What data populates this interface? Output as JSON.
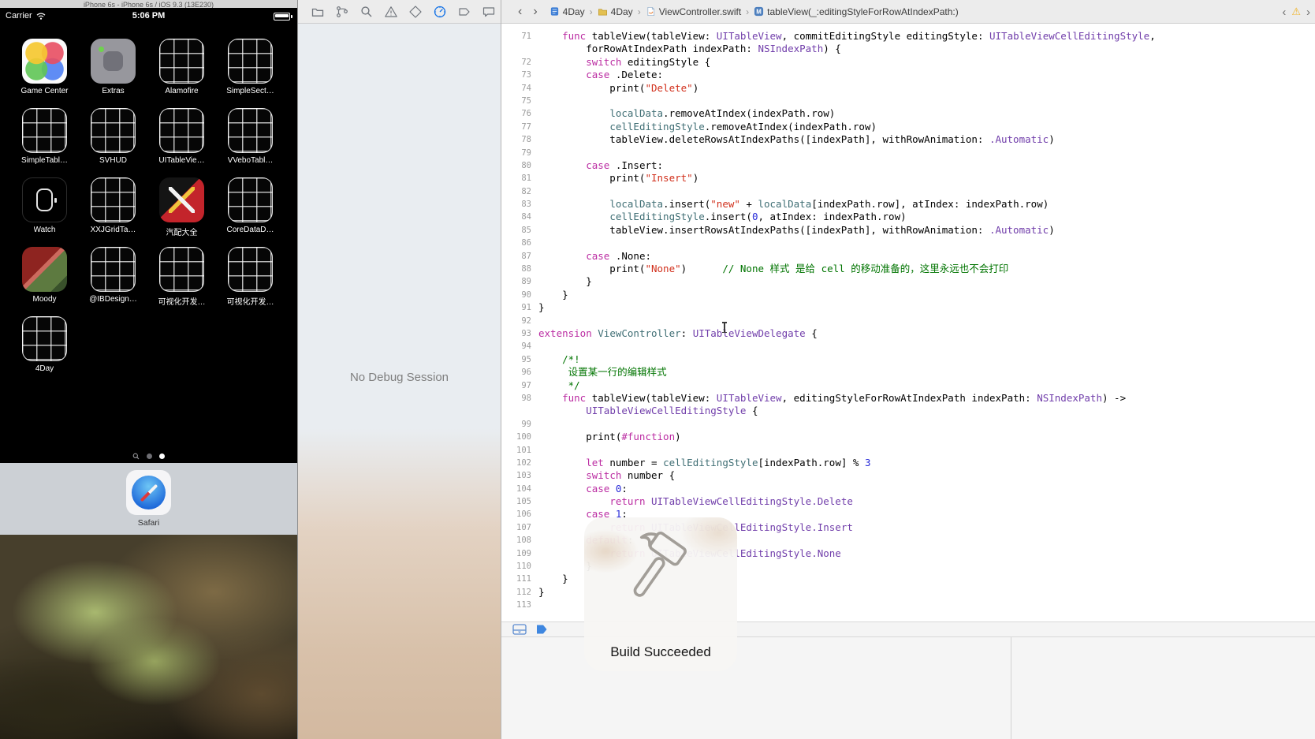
{
  "colors": {
    "accent_blue": "#1472e6",
    "warning_yellow": "#f0b429",
    "syntax": {
      "keyword": "#BB2CA2",
      "type": "#703DAA",
      "project": "#3F6E74",
      "string": "#D12F1B",
      "number": "#272AD8",
      "comment": "#007400",
      "plain": "#000000"
    }
  },
  "simulator": {
    "window_title": "iPhone 6s - iPhone 6s / iOS 9.3 (13E230)",
    "status_bar": {
      "carrier": "Carrier",
      "time": "5:06 PM",
      "icons": [
        "wifi-icon",
        "battery-icon"
      ]
    },
    "apps": [
      {
        "label": "Game Center",
        "icon": "gamecenter"
      },
      {
        "label": "Extras",
        "icon": "extras"
      },
      {
        "label": "Alamofire",
        "icon": "wire"
      },
      {
        "label": "SimpleSect…",
        "icon": "wire"
      },
      {
        "label": "SimpleTabl…",
        "icon": "wire"
      },
      {
        "label": "SVHUD",
        "icon": "wire"
      },
      {
        "label": "UITableVie…",
        "icon": "wire"
      },
      {
        "label": "VVeboTabl…",
        "icon": "wire"
      },
      {
        "label": "Watch",
        "icon": "watch"
      },
      {
        "label": "XXJGridTa…",
        "icon": "wire"
      },
      {
        "label": "汽配大全",
        "icon": "tools"
      },
      {
        "label": "CoreDataD…",
        "icon": "wire"
      },
      {
        "label": "Moody",
        "icon": "moody"
      },
      {
        "label": "@IBDesign…",
        "icon": "wire"
      },
      {
        "label": "可视化开发…",
        "icon": "wire"
      },
      {
        "label": "可视化开发…",
        "icon": "wire"
      },
      {
        "label": "4Day",
        "icon": "wire"
      }
    ],
    "page_indicator": {
      "icons": [
        "spotlight-search-icon",
        "page-dot",
        "page-dot-current"
      ],
      "current_page": 2
    },
    "dock": {
      "apps": [
        {
          "label": "Safari",
          "icon": "safari"
        }
      ]
    }
  },
  "xcode": {
    "navigator": {
      "items": [
        {
          "name": "project-navigator",
          "selected": false
        },
        {
          "name": "source-control-navigator",
          "selected": false
        },
        {
          "name": "find-navigator",
          "selected": false
        },
        {
          "name": "issue-navigator",
          "selected": false
        },
        {
          "name": "test-navigator",
          "selected": false
        },
        {
          "name": "debug-navigator",
          "selected": true
        },
        {
          "name": "breakpoint-navigator",
          "selected": false
        },
        {
          "name": "report-navigator",
          "selected": false
        }
      ]
    },
    "debug_panel": {
      "message": "No Debug Session"
    },
    "jump_bar": {
      "breadcrumbs": [
        {
          "label": "4Day",
          "icon": "project-icon"
        },
        {
          "label": "4Day",
          "icon": "folder-icon"
        },
        {
          "label": "ViewController.swift",
          "icon": "swift-file-icon"
        },
        {
          "label": "tableView(_:editingStyleForRowAtIndexPath:)",
          "icon": "method-icon"
        }
      ],
      "right_icons": [
        "previous-issue",
        "warning",
        "next-issue"
      ]
    },
    "debug_bar": {
      "buttons": [
        {
          "name": "toggle-debug-area"
        },
        {
          "name": "breakpoints-toggle"
        }
      ]
    },
    "build_bezel": {
      "label": "Build Succeeded",
      "icon": "hammer-icon"
    },
    "code": {
      "lines": [
        {
          "num": "71",
          "segs": [
            [
              "p",
              "    "
            ],
            [
              "k",
              "func"
            ],
            [
              "p",
              " tableView(tableView: "
            ],
            [
              "t",
              "UITableView"
            ],
            [
              "p",
              ", commitEditingStyle editingStyle: "
            ],
            [
              "t",
              "UITableViewCellEditingStyle"
            ],
            [
              "p",
              ","
            ]
          ]
        },
        {
          "num": "",
          "segs": [
            [
              "p",
              "        forRowAtIndexPath indexPath: "
            ],
            [
              "t",
              "NSIndexPath"
            ],
            [
              "p",
              ") {"
            ]
          ]
        },
        {
          "num": "72",
          "segs": [
            [
              "p",
              "        "
            ],
            [
              "k",
              "switch"
            ],
            [
              "p",
              " editingStyle {"
            ]
          ]
        },
        {
          "num": "73",
          "segs": [
            [
              "p",
              "        "
            ],
            [
              "k",
              "case"
            ],
            [
              "p",
              " .Delete:"
            ]
          ]
        },
        {
          "num": "74",
          "segs": [
            [
              "p",
              "            print("
            ],
            [
              "s",
              "\"Delete\""
            ],
            [
              "p",
              ")"
            ]
          ]
        },
        {
          "num": "75",
          "segs": []
        },
        {
          "num": "76",
          "segs": [
            [
              "p",
              "            "
            ],
            [
              "v",
              "localData"
            ],
            [
              "p",
              ".removeAtIndex(indexPath.row)"
            ]
          ]
        },
        {
          "num": "77",
          "segs": [
            [
              "p",
              "            "
            ],
            [
              "v",
              "cellEditingStyle"
            ],
            [
              "p",
              ".removeAtIndex(indexPath.row)"
            ]
          ]
        },
        {
          "num": "78",
          "segs": [
            [
              "p",
              "            tableView.deleteRowsAtIndexPaths([indexPath], withRowAnimation: "
            ],
            [
              "t",
              ".Automatic"
            ],
            [
              "p",
              ")"
            ]
          ]
        },
        {
          "num": "79",
          "segs": []
        },
        {
          "num": "80",
          "segs": [
            [
              "p",
              "        "
            ],
            [
              "k",
              "case"
            ],
            [
              "p",
              " .Insert:"
            ]
          ]
        },
        {
          "num": "81",
          "segs": [
            [
              "p",
              "            print("
            ],
            [
              "s",
              "\"Insert\""
            ],
            [
              "p",
              ")"
            ]
          ]
        },
        {
          "num": "82",
          "segs": []
        },
        {
          "num": "83",
          "segs": [
            [
              "p",
              "            "
            ],
            [
              "v",
              "localData"
            ],
            [
              "p",
              ".insert("
            ],
            [
              "s",
              "\"new\""
            ],
            [
              "p",
              " + "
            ],
            [
              "v",
              "localData"
            ],
            [
              "p",
              "[indexPath.row], atIndex: indexPath.row)"
            ]
          ]
        },
        {
          "num": "84",
          "segs": [
            [
              "p",
              "            "
            ],
            [
              "v",
              "cellEditingStyle"
            ],
            [
              "p",
              ".insert("
            ],
            [
              "n",
              "0"
            ],
            [
              "p",
              ", atIndex: indexPath.row)"
            ]
          ]
        },
        {
          "num": "85",
          "segs": [
            [
              "p",
              "            tableView.insertRowsAtIndexPaths([indexPath], withRowAnimation: "
            ],
            [
              "t",
              ".Automatic"
            ],
            [
              "p",
              ")"
            ]
          ]
        },
        {
          "num": "86",
          "segs": []
        },
        {
          "num": "87",
          "segs": [
            [
              "p",
              "        "
            ],
            [
              "k",
              "case"
            ],
            [
              "p",
              " .None:"
            ]
          ]
        },
        {
          "num": "88",
          "segs": [
            [
              "p",
              "            print("
            ],
            [
              "s",
              "\"None\""
            ],
            [
              "p",
              ")      "
            ],
            [
              "c",
              "// None 样式 是给 cell 的移动准备的，这里永远也不会打印"
            ]
          ]
        },
        {
          "num": "89",
          "segs": [
            [
              "p",
              "        }"
            ]
          ]
        },
        {
          "num": "90",
          "segs": [
            [
              "p",
              "    }"
            ]
          ]
        },
        {
          "num": "91",
          "segs": [
            [
              "p",
              "}"
            ]
          ]
        },
        {
          "num": "92",
          "segs": []
        },
        {
          "num": "93",
          "segs": [
            [
              "k",
              "extension"
            ],
            [
              "p",
              " "
            ],
            [
              "v",
              "ViewController"
            ],
            [
              "p",
              ": "
            ],
            [
              "t",
              "UITableViewDelegate"
            ],
            [
              "p",
              " {"
            ]
          ]
        },
        {
          "num": "94",
          "segs": []
        },
        {
          "num": "95",
          "segs": [
            [
              "p",
              "    "
            ],
            [
              "c",
              "/*!"
            ]
          ]
        },
        {
          "num": "96",
          "segs": [
            [
              "c",
              "     设置某一行的编辑样式"
            ]
          ]
        },
        {
          "num": "97",
          "segs": [
            [
              "c",
              "     */"
            ]
          ]
        },
        {
          "num": "98",
          "segs": [
            [
              "p",
              "    "
            ],
            [
              "k",
              "func"
            ],
            [
              "p",
              " tableView(tableView: "
            ],
            [
              "t",
              "UITableView"
            ],
            [
              "p",
              ", editingStyleForRowAtIndexPath indexPath: "
            ],
            [
              "t",
              "NSIndexPath"
            ],
            [
              "p",
              ") ->"
            ]
          ]
        },
        {
          "num": "",
          "segs": [
            [
              "p",
              "        "
            ],
            [
              "t",
              "UITableViewCellEditingStyle"
            ],
            [
              "p",
              " {"
            ]
          ]
        },
        {
          "num": "99",
          "segs": []
        },
        {
          "num": "100",
          "segs": [
            [
              "p",
              "        print("
            ],
            [
              "k",
              "#function"
            ],
            [
              "p",
              ")"
            ]
          ]
        },
        {
          "num": "101",
          "segs": []
        },
        {
          "num": "102",
          "segs": [
            [
              "p",
              "        "
            ],
            [
              "k",
              "let"
            ],
            [
              "p",
              " number = "
            ],
            [
              "v",
              "cellEditingStyle"
            ],
            [
              "p",
              "[indexPath.row] % "
            ],
            [
              "n",
              "3"
            ]
          ]
        },
        {
          "num": "103",
          "segs": [
            [
              "p",
              "        "
            ],
            [
              "k",
              "switch"
            ],
            [
              "p",
              " number {"
            ]
          ]
        },
        {
          "num": "104",
          "segs": [
            [
              "p",
              "        "
            ],
            [
              "k",
              "case"
            ],
            [
              "p",
              " "
            ],
            [
              "n",
              "0"
            ],
            [
              "p",
              ":"
            ]
          ]
        },
        {
          "num": "105",
          "segs": [
            [
              "p",
              "            "
            ],
            [
              "k",
              "return"
            ],
            [
              "p",
              " "
            ],
            [
              "t",
              "UITableViewCellEditingStyle.Delete"
            ]
          ]
        },
        {
          "num": "106",
          "segs": [
            [
              "p",
              "        "
            ],
            [
              "k",
              "case"
            ],
            [
              "p",
              " "
            ],
            [
              "n",
              "1"
            ],
            [
              "p",
              ":"
            ]
          ]
        },
        {
          "num": "107",
          "segs": [
            [
              "p",
              "            "
            ],
            [
              "k",
              "return"
            ],
            [
              "p",
              " "
            ],
            [
              "t",
              "UITableViewCellEditingStyle.Insert"
            ]
          ]
        },
        {
          "num": "108",
          "segs": [
            [
              "p",
              "        "
            ],
            [
              "k",
              "default"
            ],
            [
              "p",
              ":"
            ]
          ]
        },
        {
          "num": "109",
          "segs": [
            [
              "p",
              "            "
            ],
            [
              "k",
              "return"
            ],
            [
              "p",
              " "
            ],
            [
              "t",
              "UITableViewCellEditingStyle.None"
            ]
          ]
        },
        {
          "num": "110",
          "segs": [
            [
              "p",
              "        }"
            ]
          ]
        },
        {
          "num": "111",
          "segs": [
            [
              "p",
              "    }"
            ]
          ]
        },
        {
          "num": "112",
          "segs": [
            [
              "p",
              "}"
            ]
          ]
        },
        {
          "num": "113",
          "segs": []
        }
      ]
    }
  }
}
